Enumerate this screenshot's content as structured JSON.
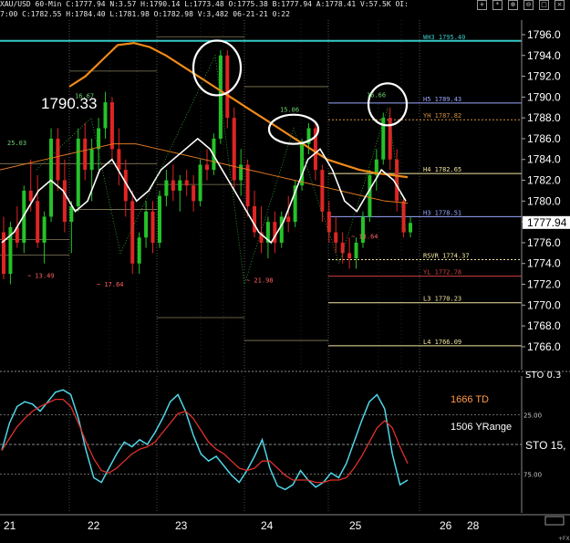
{
  "header": {
    "symbol_line": "XAU/USD  60-Min  C:1777.94  N:3.57  H:1790.14  L:1773.48  O:1775.38  B:1777.94  A:1778.41  V:57.5K  OI:",
    "ohlc_line": "7:00  C:1782.55  H:1784.40  L:1781.98  O:1782.98  V:3,482  06-21-21  0:22"
  },
  "chart_data": [
    {
      "type": "line",
      "title": "XAU/USD 60-Min",
      "price_axis": {
        "ticks": [
          1766,
          1768,
          1770,
          1772,
          1774,
          1776,
          1778,
          1780,
          1782,
          1784,
          1786,
          1788,
          1790,
          1792,
          1794,
          1796
        ],
        "ylim": [
          1763.8,
          1797.4
        ],
        "current_price": "1777.94"
      },
      "time_axis": {
        "labels": [
          "21",
          "22",
          "23",
          "24",
          "25",
          "26",
          "28"
        ]
      },
      "candles_ohlc": [
        [
          1777.0,
          1778.5,
          1772.5,
          1773.0
        ],
        [
          1773.0,
          1778.0,
          1772.0,
          1777.5
        ],
        [
          1777.5,
          1779.5,
          1775.5,
          1776.0
        ],
        [
          1776.0,
          1781.5,
          1775.0,
          1781.0
        ],
        [
          1781.0,
          1784.0,
          1779.0,
          1780.0
        ],
        [
          1780.0,
          1782.5,
          1775.5,
          1776.0
        ],
        [
          1776.0,
          1779.0,
          1774.0,
          1778.5
        ],
        [
          1778.5,
          1787.0,
          1778.0,
          1786.0
        ],
        [
          1786.0,
          1787.0,
          1781.0,
          1782.0
        ],
        [
          1782.0,
          1784.0,
          1777.0,
          1778.0
        ],
        [
          1778.0,
          1780.0,
          1775.0,
          1779.5
        ],
        [
          1779.5,
          1787.0,
          1779.0,
          1786.0
        ],
        [
          1786.0,
          1787.5,
          1782.0,
          1783.0
        ],
        [
          1783.0,
          1786.0,
          1780.0,
          1785.0
        ],
        [
          1785.0,
          1788.0,
          1783.0,
          1787.0
        ],
        [
          1787.0,
          1790.5,
          1786.0,
          1789.5
        ],
        [
          1789.5,
          1790.0,
          1784.0,
          1785.0
        ],
        [
          1785.0,
          1787.0,
          1781.5,
          1783.0
        ],
        [
          1783.0,
          1784.0,
          1778.5,
          1780.0
        ],
        [
          1780.0,
          1781.0,
          1773.0,
          1774.0
        ],
        [
          1774.0,
          1777.0,
          1773.0,
          1776.5
        ],
        [
          1776.5,
          1780.0,
          1775.5,
          1779.0
        ],
        [
          1779.0,
          1780.0,
          1775.0,
          1776.0
        ],
        [
          1776.0,
          1781.0,
          1775.5,
          1780.5
        ],
        [
          1780.5,
          1783.0,
          1779.5,
          1782.0
        ],
        [
          1782.0,
          1783.5,
          1780.0,
          1781.0
        ],
        [
          1781.0,
          1782.5,
          1779.0,
          1782.0
        ],
        [
          1782.0,
          1783.0,
          1780.5,
          1781.5
        ],
        [
          1781.5,
          1782.5,
          1779.0,
          1780.0
        ],
        [
          1780.0,
          1784.0,
          1779.5,
          1783.5
        ],
        [
          1783.5,
          1785.0,
          1782.0,
          1783.0
        ],
        [
          1783.0,
          1786.5,
          1782.5,
          1786.0
        ],
        [
          1786.0,
          1794.5,
          1785.5,
          1794.0
        ],
        [
          1794.0,
          1794.5,
          1787.0,
          1788.0
        ],
        [
          1788.0,
          1789.0,
          1781.0,
          1782.0
        ],
        [
          1782.0,
          1785.0,
          1780.5,
          1783.5
        ],
        [
          1783.5,
          1784.0,
          1778.5,
          1779.5
        ],
        [
          1779.5,
          1781.0,
          1776.5,
          1777.0
        ],
        [
          1777.0,
          1779.5,
          1775.0,
          1776.0
        ],
        [
          1776.0,
          1778.5,
          1774.5,
          1778.0
        ],
        [
          1778.0,
          1779.0,
          1775.0,
          1776.0
        ],
        [
          1776.0,
          1779.0,
          1775.5,
          1778.5
        ],
        [
          1778.5,
          1780.5,
          1777.0,
          1778.0
        ],
        [
          1778.0,
          1782.0,
          1777.5,
          1781.5
        ],
        [
          1781.5,
          1786.0,
          1781.0,
          1785.5
        ],
        [
          1785.5,
          1787.5,
          1784.5,
          1787.0
        ],
        [
          1787.0,
          1787.5,
          1782.0,
          1783.0
        ],
        [
          1783.0,
          1783.5,
          1778.0,
          1779.0
        ],
        [
          1779.0,
          1780.0,
          1776.0,
          1777.0
        ],
        [
          1777.0,
          1778.5,
          1775.0,
          1776.0
        ],
        [
          1776.0,
          1777.0,
          1774.0,
          1775.0
        ],
        [
          1775.0,
          1776.5,
          1773.5,
          1774.5
        ],
        [
          1774.5,
          1776.5,
          1773.5,
          1776.0
        ],
        [
          1776.0,
          1779.0,
          1775.5,
          1778.5
        ],
        [
          1778.5,
          1783.0,
          1778.0,
          1782.5
        ],
        [
          1782.5,
          1785.0,
          1781.0,
          1784.0
        ],
        [
          1784.0,
          1788.5,
          1783.5,
          1788.0
        ],
        [
          1788.0,
          1789.0,
          1783.0,
          1784.0
        ],
        [
          1784.0,
          1785.0,
          1779.0,
          1780.0
        ],
        [
          1780.0,
          1780.5,
          1776.5,
          1777.0
        ],
        [
          1777.0,
          1778.5,
          1776.5,
          1777.9
        ]
      ],
      "indicators": {
        "ma_orange_thick": [
          1791,
          1792,
          1793.5,
          1795,
          1795.2,
          1794.8,
          1794,
          1793,
          1792,
          1791,
          1790,
          1789,
          1788,
          1787,
          1786,
          1785,
          1784,
          1783.5,
          1783,
          1782.7,
          1782.5,
          1782.3
        ],
        "ma_white": [
          1776,
          1777,
          1779,
          1781,
          1782,
          1781,
          1779,
          1780,
          1783,
          1784,
          1782,
          1780,
          1781,
          1783,
          1784,
          1785,
          1786,
          1785,
          1783,
          1781,
          1779,
          1777,
          1776,
          1778,
          1781,
          1784,
          1785,
          1783,
          1780,
          1779,
          1781,
          1783,
          1782,
          1780
        ],
        "ma_orange_thin": [
          1783,
          1783.5,
          1784,
          1784.5,
          1785,
          1785.5,
          1785.5,
          1785,
          1784.5,
          1784,
          1783.5,
          1783,
          1782.5,
          1782,
          1781.5,
          1781,
          1780.5,
          1780,
          1779.8
        ]
      },
      "levels": [
        {
          "label": "WH3 1795.40",
          "value": 1795.4,
          "color": "#38c8c8"
        },
        {
          "label": "H5 1789.43",
          "value": 1789.43,
          "color": "#9aa6ff"
        },
        {
          "label": "YH 1787.82",
          "value": 1787.82,
          "color": "#d09040"
        },
        {
          "label": "H4 1782.65",
          "value": 1782.65,
          "color": "#f2e6a0"
        },
        {
          "label": "H3 1778.51",
          "value": 1778.51,
          "color": "#9aa6ff"
        },
        {
          "label": "RSVR 1774.37",
          "value": 1774.37,
          "color": "#f2e6a0"
        },
        {
          "label": "YL 1772.78",
          "value": 1772.78,
          "color": "#d04040"
        },
        {
          "label": "L3 1770.23",
          "value": 1770.23,
          "color": "#f2e6a0"
        },
        {
          "label": "L4 1766.09",
          "value": 1766.09,
          "color": "#f2e6a0"
        }
      ],
      "annotations": [
        {
          "text": "1790.33",
          "big": true
        },
        {
          "text": "25.03",
          "color": "#6cd26c"
        },
        {
          "text": "16.67",
          "color": "#6cd26c"
        },
        {
          "text": "15.06",
          "color": "#6cd26c"
        },
        {
          "text": "16.66",
          "color": "#6cd26c"
        },
        {
          "text": "~ 13.49",
          "color": "#ff6060"
        },
        {
          "text": "~ 17.64",
          "color": "#ff6060"
        },
        {
          "text": "~ 21.98",
          "color": "#ff6060"
        },
        {
          "text": "~ 13.64",
          "color": "#ff6060"
        }
      ]
    },
    {
      "type": "line",
      "title": "STO 15,",
      "ticks": [
        "25.00",
        "75.00"
      ],
      "ylim": [
        0,
        100
      ],
      "labels": [
        {
          "text": "1666 TD",
          "color": "#ff9a4a"
        },
        {
          "text": "1506 YRange",
          "color": "#ffffff"
        }
      ],
      "series": [
        {
          "color": "#4fd6e8",
          "values": [
            55,
            32,
            18,
            14,
            16,
            22,
            14,
            6,
            4,
            8,
            28,
            55,
            78,
            82,
            70,
            58,
            48,
            52,
            46,
            50,
            40,
            28,
            14,
            8,
            22,
            42,
            58,
            64,
            60,
            68,
            76,
            82,
            72,
            60,
            46,
            70,
            85,
            88,
            84,
            72,
            80,
            86,
            82,
            74,
            78,
            66,
            48,
            30,
            14,
            8,
            20,
            58,
            84,
            80
          ]
        },
        {
          "color": "#e0302a",
          "values": [
            55,
            45,
            35,
            28,
            22,
            18,
            15,
            12,
            12,
            18,
            32,
            48,
            62,
            72,
            74,
            70,
            64,
            58,
            54,
            52,
            48,
            40,
            32,
            24,
            22,
            28,
            38,
            48,
            54,
            58,
            64,
            70,
            72,
            70,
            64,
            64,
            70,
            76,
            80,
            80,
            80,
            82,
            82,
            80,
            80,
            78,
            70,
            60,
            48,
            36,
            30,
            36,
            52,
            66
          ]
        }
      ]
    }
  ]
}
